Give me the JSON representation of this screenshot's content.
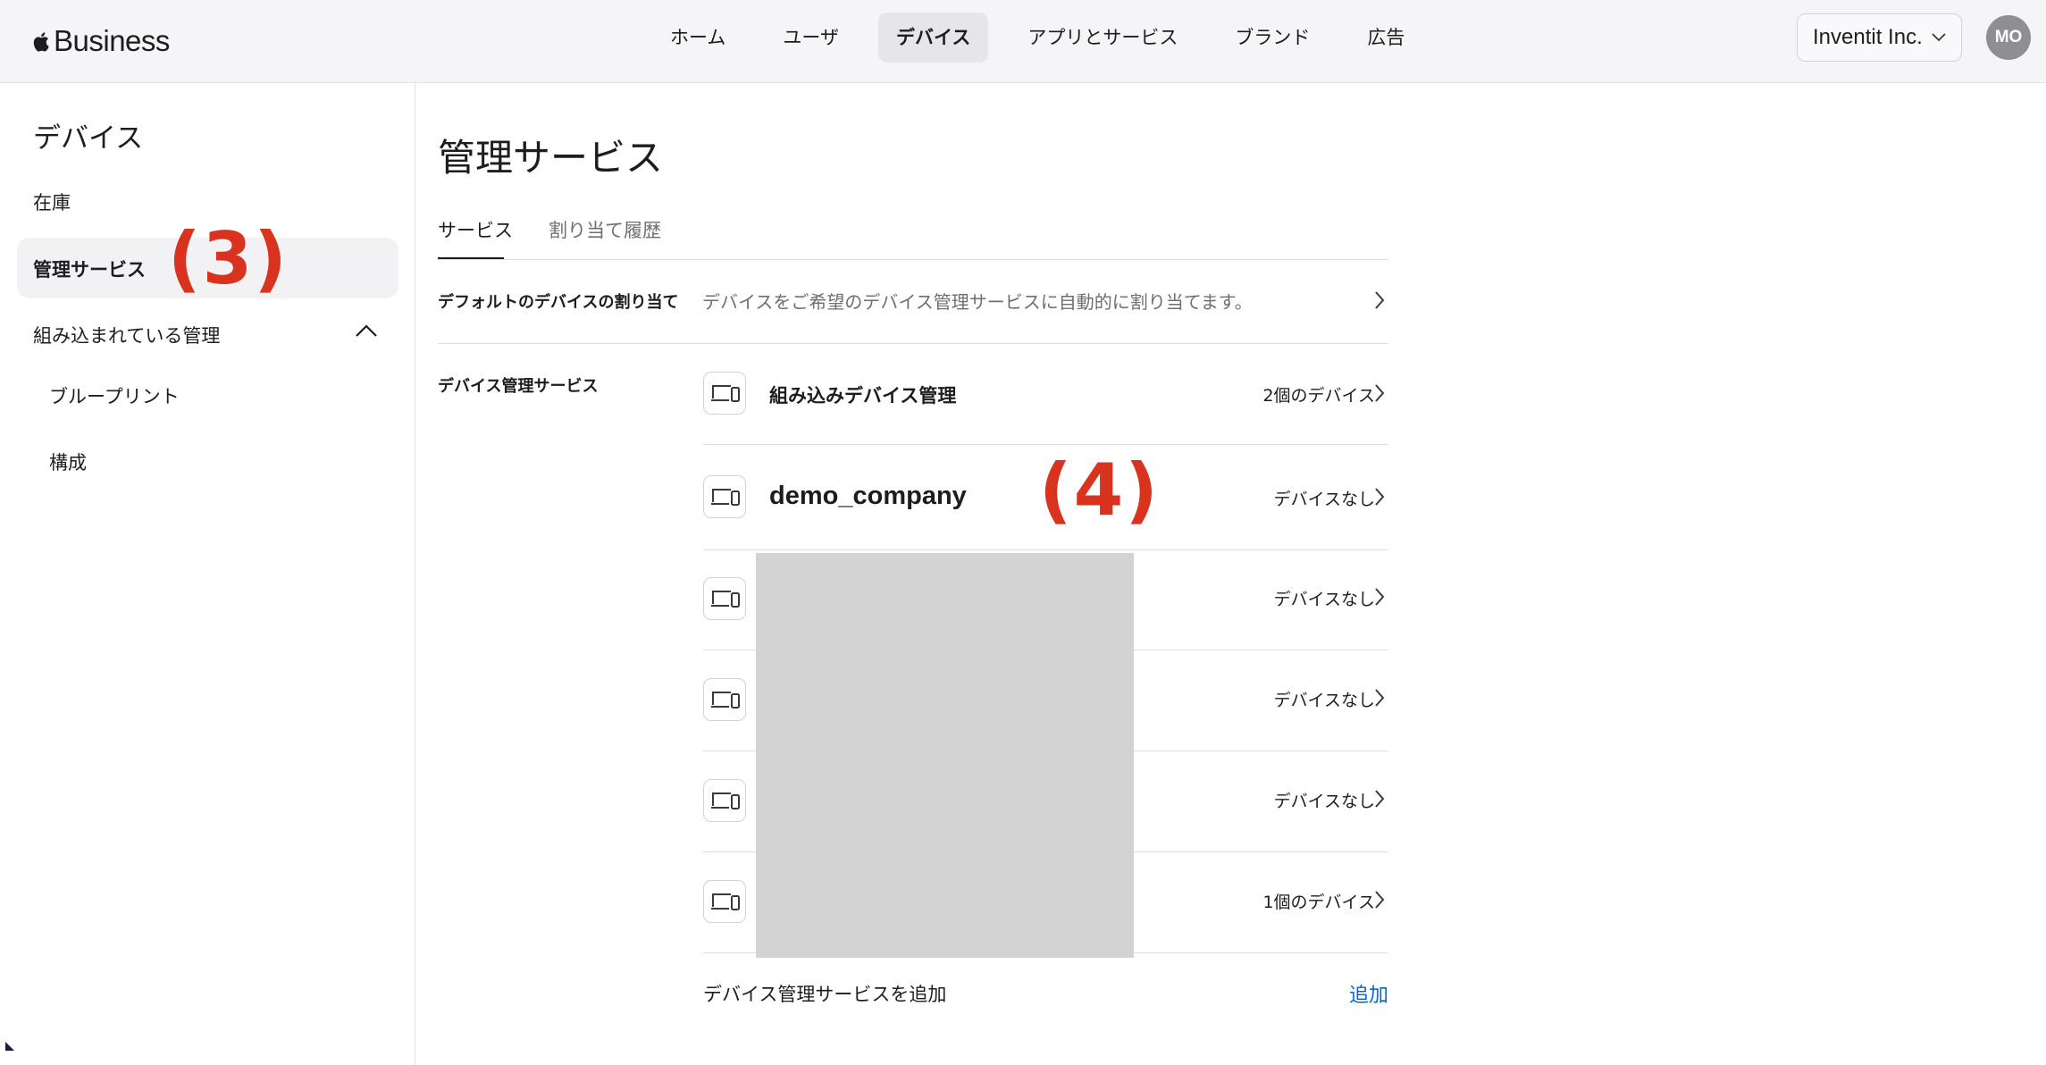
{
  "brand": {
    "name": "Business",
    "logo_icon": "apple-logo-icon"
  },
  "nav": {
    "items": [
      {
        "label": "ホーム",
        "active": false
      },
      {
        "label": "ユーザ",
        "active": false
      },
      {
        "label": "デバイス",
        "active": true
      },
      {
        "label": "アプリとサービス",
        "active": false
      },
      {
        "label": "ブランド",
        "active": false
      },
      {
        "label": "広告",
        "active": false
      }
    ]
  },
  "org_selector": {
    "value": "Inventit Inc."
  },
  "avatar": {
    "initials": "MO"
  },
  "sidebar": {
    "title": "デバイス",
    "items": [
      {
        "label": "在庫"
      },
      {
        "label": "管理サービス",
        "active": true
      },
      {
        "label": "組み込まれている管理",
        "expanded": true
      },
      {
        "label": "ブループリント"
      },
      {
        "label": "構成"
      }
    ]
  },
  "annotations": {
    "step3": "(3)",
    "step4": "(4)"
  },
  "main": {
    "title": "管理サービス",
    "tabs": [
      {
        "label": "サービス",
        "active": true
      },
      {
        "label": "割り当て履歴",
        "active": false
      }
    ],
    "default_assignment": {
      "label": "デフォルトのデバイスの割り当て",
      "description": "デバイスをご希望のデバイス管理サービスに自動的に割り当てます。"
    },
    "mdm_section": {
      "label": "デバイス管理サービス",
      "services": [
        {
          "name": "組み込みデバイス管理",
          "count": "2個のデバイス"
        },
        {
          "name": "demo_company",
          "count": "デバイスなし"
        },
        {
          "name": "",
          "count": "デバイスなし"
        },
        {
          "name": "",
          "count": "デバイスなし"
        },
        {
          "name": "",
          "count": "デバイスなし"
        },
        {
          "name": "",
          "count": "1個のデバイス"
        }
      ]
    },
    "add_service": {
      "label": "デバイス管理サービスを追加",
      "action": "追加"
    }
  },
  "colors": {
    "accent_link": "#0066cc",
    "annotation_red": "#d9321f",
    "redaction_gray": "#d3d3d3"
  }
}
